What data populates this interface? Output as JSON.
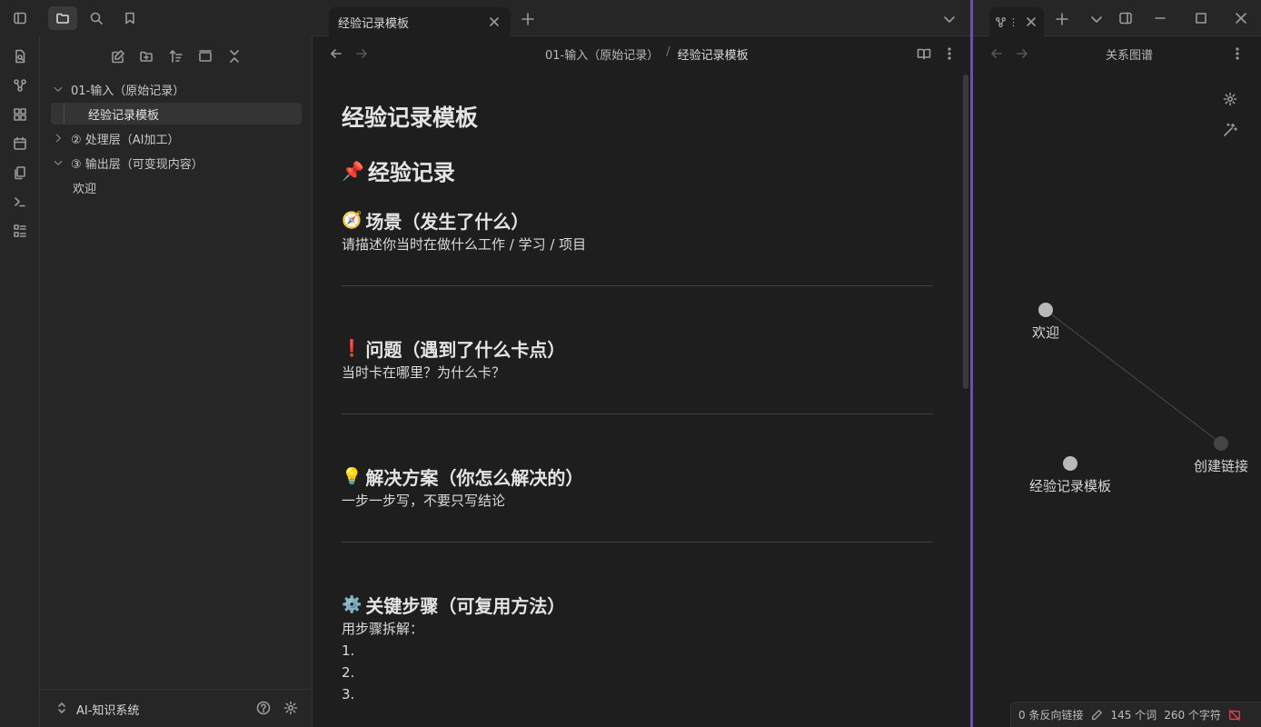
{
  "tabs": {
    "main": {
      "label": "经验记录模板"
    },
    "graph": {
      "label": "关系图谱"
    }
  },
  "sidebar": {
    "tree": [
      {
        "label": "01-输入（原始记录）",
        "type": "folder",
        "expanded": true
      },
      {
        "label": "经验记录模板",
        "type": "file",
        "selected": true
      },
      {
        "label": "② 处理层（AI加工）",
        "type": "folder",
        "expanded": false
      },
      {
        "label": "③ 输出层（可变现内容）",
        "type": "folder",
        "expanded": true
      },
      {
        "label": "欢迎",
        "type": "file"
      }
    ],
    "vault_name": "AI-知识系统"
  },
  "editor": {
    "breadcrumb": {
      "parent": "01-输入（原始记录）",
      "separator": "/",
      "current": "经验记录模板"
    },
    "doc": {
      "title": "经验记录模板",
      "h2": {
        "emoji": "📌",
        "text": "经验记录"
      },
      "sections": [
        {
          "emoji": "🧭",
          "heading": "场景（发生了什么）",
          "body": "请描述你当时在做什么工作 / 学习 / 项目"
        },
        {
          "emoji": "❗",
          "heading": "问题（遇到了什么卡点）",
          "body": "当时卡在哪里？为什么卡？"
        },
        {
          "emoji": "💡",
          "heading": "解决方案（你怎么解决的）",
          "body": "一步一步写，不要只写结论"
        },
        {
          "emoji": "⚙️",
          "heading": "关键步骤（可复用方法）",
          "body": "用步骤拆解："
        }
      ],
      "list": [
        "1.",
        "2.",
        "3."
      ]
    }
  },
  "graph": {
    "title": "关系图谱",
    "nodes": [
      {
        "label": "欢迎",
        "state": "resolved"
      },
      {
        "label": "经验记录模板",
        "state": "resolved"
      },
      {
        "label": "创建链接",
        "state": "unresolved"
      }
    ],
    "edges": [
      [
        "欢迎",
        "创建链接"
      ]
    ]
  },
  "status": {
    "backlinks": "0 条反向链接",
    "words": "145 个词",
    "chars": "260 个字符"
  },
  "colors": {
    "accent": "#6a4fb3",
    "background": "#1e1e1e",
    "panel": "#262626"
  }
}
